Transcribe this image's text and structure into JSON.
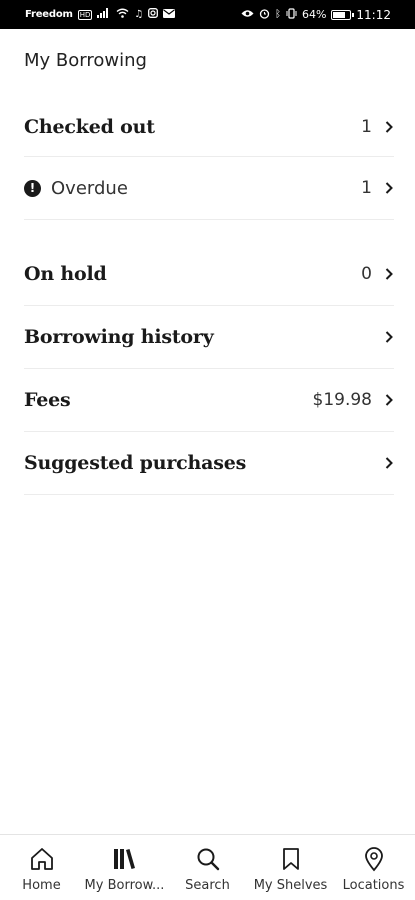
{
  "status_bar": {
    "carrier": "Freedom",
    "carrier_badge": "HD",
    "battery_percent": "64%",
    "time": "11:12"
  },
  "page": {
    "title": "My Borrowing"
  },
  "list": {
    "checked_out": {
      "label": "Checked out",
      "value": "1"
    },
    "overdue": {
      "label": "Overdue",
      "value": "1",
      "icon": "alert-icon"
    },
    "on_hold": {
      "label": "On hold",
      "value": "0"
    },
    "history": {
      "label": "Borrowing history"
    },
    "fees": {
      "label": "Fees",
      "value": "$19.98"
    },
    "suggested": {
      "label": "Suggested purchases"
    }
  },
  "bottom_nav": {
    "home": {
      "label": "Home",
      "icon": "home-icon"
    },
    "borrowing": {
      "label": "My Borrow...",
      "icon": "books-icon"
    },
    "search": {
      "label": "Search",
      "icon": "search-icon"
    },
    "shelves": {
      "label": "My Shelves",
      "icon": "bookmark-icon"
    },
    "locations": {
      "label": "Locations",
      "icon": "location-pin-icon"
    }
  }
}
